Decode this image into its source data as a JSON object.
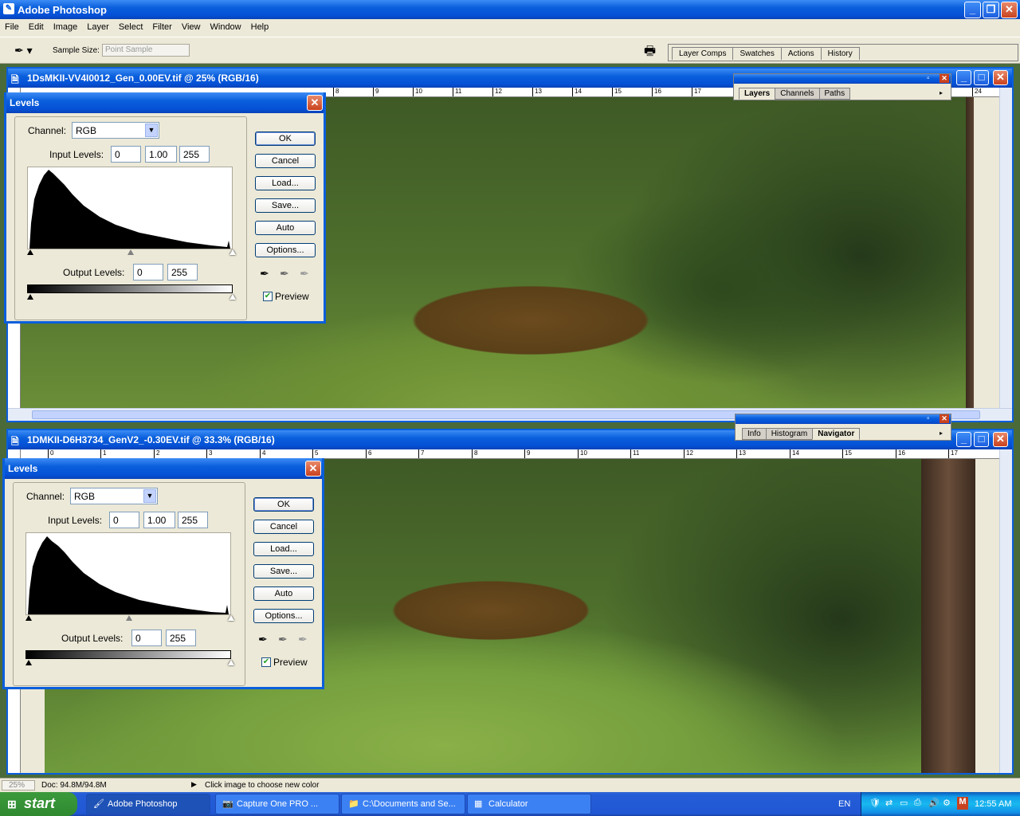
{
  "app": {
    "title": "Adobe Photoshop"
  },
  "menu": [
    "File",
    "Edit",
    "Image",
    "Layer",
    "Select",
    "Filter",
    "View",
    "Window",
    "Help"
  ],
  "options": {
    "sample_size_label": "Sample Size:",
    "sample_size_value": "Point Sample"
  },
  "palette_well": {
    "tabs": [
      "Layer Comps",
      "Swatches",
      "Actions",
      "History"
    ]
  },
  "layers_palette": {
    "tabs": [
      "Layers",
      "Channels",
      "Paths"
    ]
  },
  "navigator_palette": {
    "tabs": [
      "Info",
      "Histogram",
      "Navigator"
    ]
  },
  "doc1": {
    "title": "1DsMKII-VV4I0012_Gen_0.00EV.tif @ 25% (RGB/16)",
    "ruler_ticks": [
      "8",
      "9",
      "10",
      "11",
      "12",
      "13",
      "14",
      "15",
      "16",
      "17",
      "24"
    ]
  },
  "doc2": {
    "title": "1DMKII-D6H3734_GenV2_-0.30EV.tif @ 33.3% (RGB/16)",
    "ruler_ticks": [
      "0",
      "1",
      "2",
      "3",
      "4",
      "5",
      "6",
      "7",
      "8",
      "9",
      "10",
      "11",
      "12",
      "13",
      "14",
      "15",
      "16",
      "17"
    ]
  },
  "levels1": {
    "title": "Levels",
    "channel_label": "Channel:",
    "channel": "RGB",
    "input_label": "Input Levels:",
    "input_black": "0",
    "input_gamma": "1.00",
    "input_white": "255",
    "output_label": "Output Levels:",
    "output_black": "0",
    "output_white": "255",
    "ok": "OK",
    "cancel": "Cancel",
    "load": "Load...",
    "save": "Save...",
    "auto": "Auto",
    "options": "Options...",
    "preview": "Preview"
  },
  "levels2": {
    "title": "Levels",
    "channel_label": "Channel:",
    "channel": "RGB",
    "input_label": "Input Levels:",
    "input_black": "0",
    "input_gamma": "1.00",
    "input_white": "255",
    "output_label": "Output Levels:",
    "output_black": "0",
    "output_white": "255",
    "ok": "OK",
    "cancel": "Cancel",
    "load": "Load...",
    "save": "Save...",
    "auto": "Auto",
    "options": "Options...",
    "preview": "Preview"
  },
  "status": {
    "zoom": "25%",
    "doc": "Doc: 94.8M/94.8M",
    "hint": "Click image to choose new color"
  },
  "taskbar": {
    "start": "start",
    "buttons": [
      "Adobe Photoshop",
      "Capture One PRO ...",
      "C:\\Documents and Se...",
      "Calculator"
    ],
    "lang": "EN",
    "clock": "12:55 AM"
  }
}
